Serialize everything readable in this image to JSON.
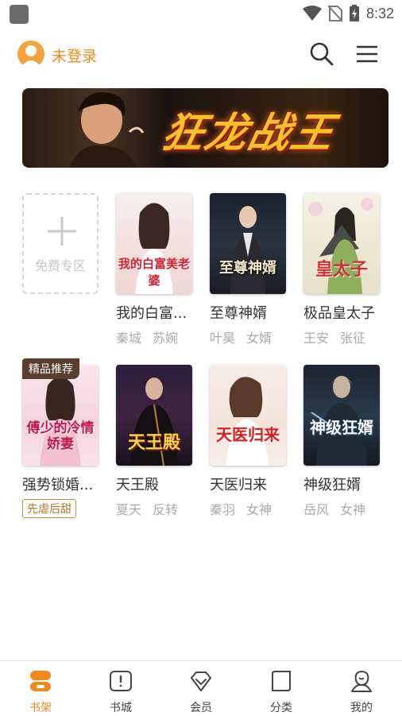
{
  "status_bar": {
    "time": "8:32"
  },
  "header": {
    "login_label": "未登录"
  },
  "banner": {
    "title": "狂龙战王"
  },
  "free_zone": {
    "label": "免费专区"
  },
  "books": [
    {
      "title": "我的白富...",
      "tags": [
        "秦城",
        "苏婉"
      ],
      "cover_text": "我的白富美老婆"
    },
    {
      "title": "至尊神婿",
      "tags": [
        "叶昊",
        "女婿"
      ],
      "cover_text": "至尊神婿"
    },
    {
      "title": "极品皇太子",
      "tags": [
        "王安",
        "张征"
      ],
      "cover_text": "皇太子"
    },
    {
      "title": "强势锁婚...",
      "badge": "精品推荐",
      "label_tag": "先虐后甜",
      "cover_text": "傅少的冷情娇妻"
    },
    {
      "title": "天王殿",
      "tags": [
        "夏天",
        "反转"
      ],
      "cover_text": "天王殿"
    },
    {
      "title": "天医归来",
      "tags": [
        "秦羽",
        "女神"
      ],
      "cover_text": "天医归来"
    },
    {
      "title": "神级狂婿",
      "tags": [
        "岳风",
        "女神"
      ],
      "cover_text": "神级狂婿"
    }
  ],
  "bottom_nav": [
    {
      "label": "书架",
      "icon": "bookshelf-icon",
      "active": true
    },
    {
      "label": "书城",
      "icon": "bookstore-icon"
    },
    {
      "label": "会员",
      "icon": "vip-diamond-icon"
    },
    {
      "label": "分类",
      "icon": "category-icon"
    },
    {
      "label": "我的",
      "icon": "profile-icon"
    }
  ],
  "colors": {
    "accent": "#f08a1c",
    "tag_border": "#c98e3c"
  }
}
